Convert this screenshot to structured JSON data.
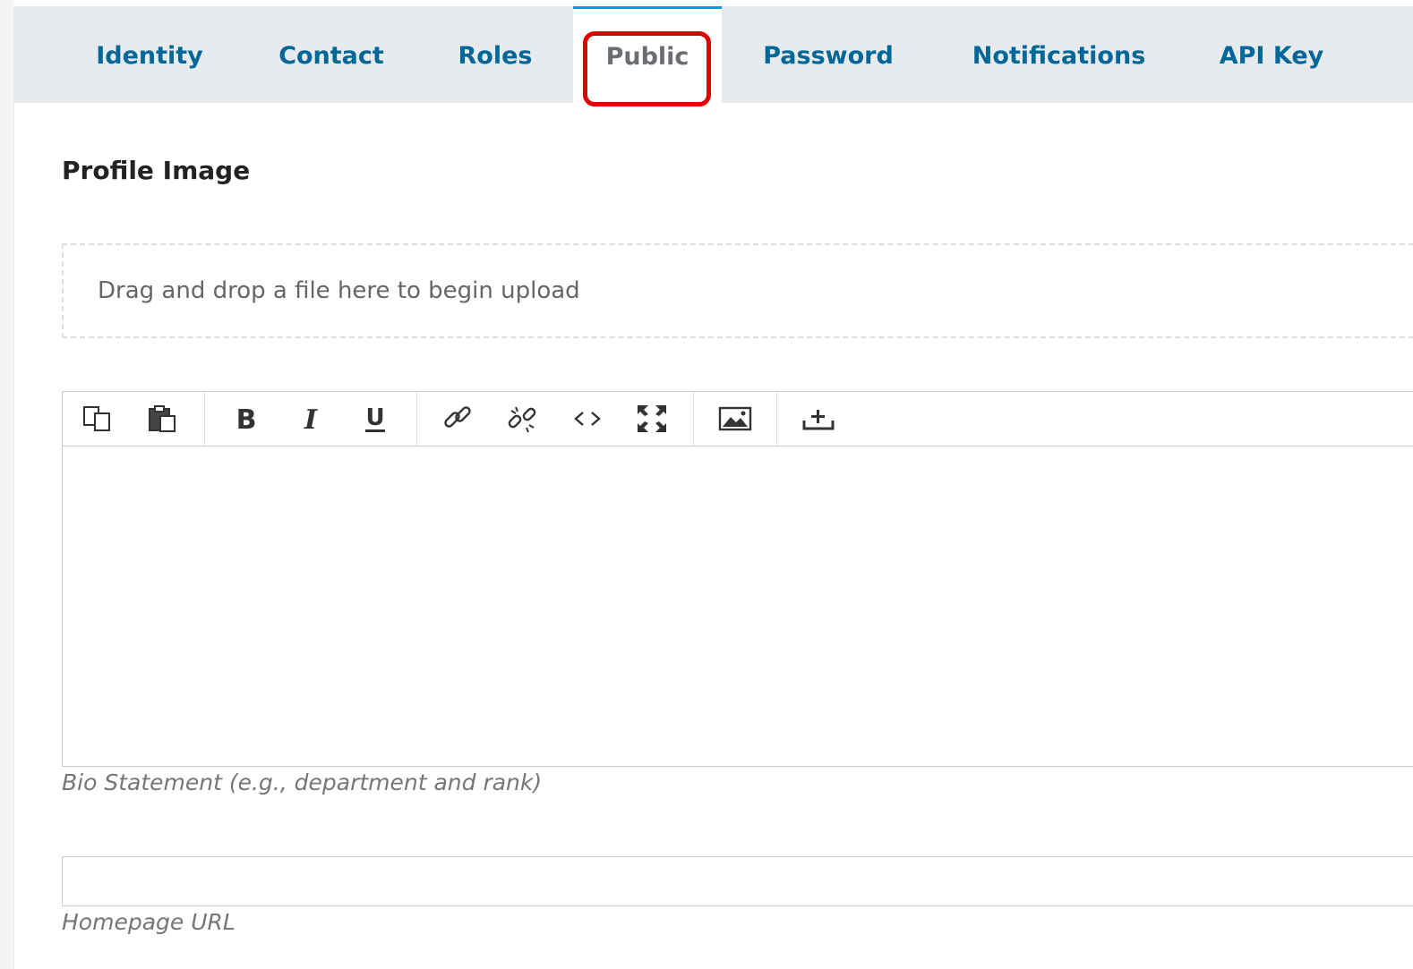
{
  "tabs": [
    {
      "label": "Identity",
      "active": false
    },
    {
      "label": "Contact",
      "active": false
    },
    {
      "label": "Roles",
      "active": false
    },
    {
      "label": "Public",
      "active": true
    },
    {
      "label": "Password",
      "active": false
    },
    {
      "label": "Notifications",
      "active": false
    },
    {
      "label": "API Key",
      "active": false
    }
  ],
  "profile_image": {
    "heading": "Profile Image",
    "dropzone_text": "Drag and drop a file here to begin upload"
  },
  "editor": {
    "toolbar_icons": [
      "copy-icon",
      "paste-icon",
      "bold-icon",
      "italic-icon",
      "underline-icon",
      "link-icon",
      "unlink-icon",
      "code-icon",
      "fullscreen-icon",
      "image-icon",
      "upload-icon"
    ],
    "content": "",
    "caption": "Bio Statement (e.g., department and rank)"
  },
  "homepage": {
    "value": "",
    "caption": "Homepage URL"
  },
  "colors": {
    "tab_link": "#006798",
    "tab_active_border": "#009fdb",
    "highlight": "#e00000"
  }
}
